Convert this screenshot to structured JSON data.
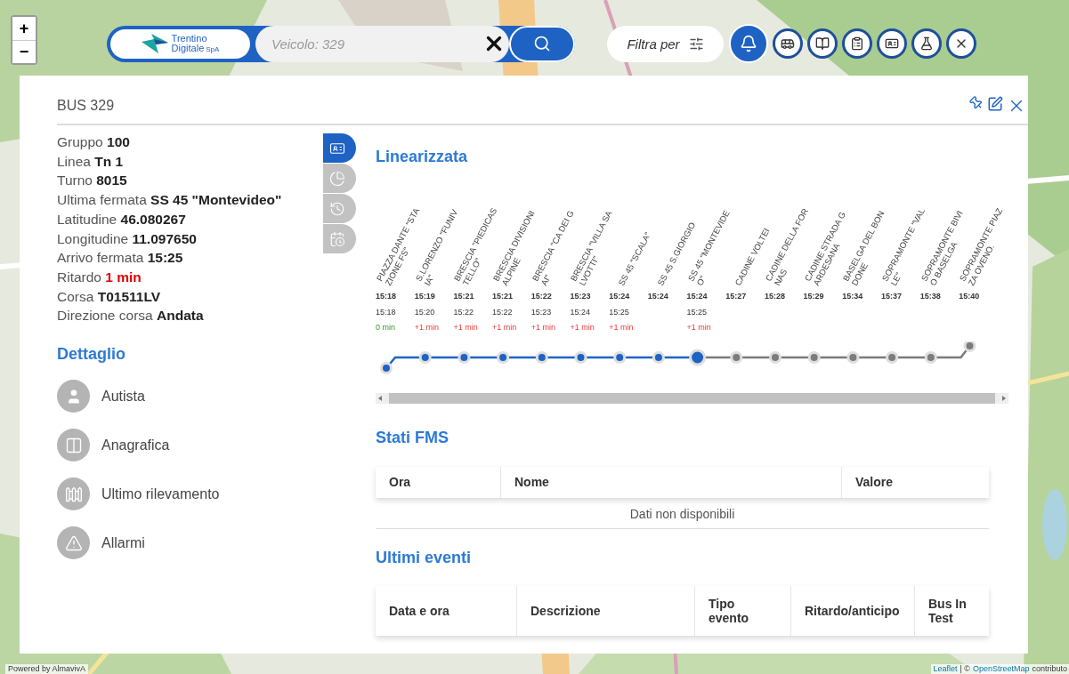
{
  "map_controls": {
    "zoom_in": "+",
    "zoom_out": "−"
  },
  "toolbar": {
    "logo": {
      "line1": "Trentino",
      "line2": "Digitale",
      "suffix": "SpA"
    },
    "search": {
      "placeholder": "Veicolo: 329"
    },
    "filter": {
      "label": "Filtra per"
    },
    "icon_buttons": [
      {
        "kind": "bell",
        "selected": true
      },
      {
        "kind": "bus",
        "selected": false
      },
      {
        "kind": "book",
        "selected": false
      },
      {
        "kind": "clipboard",
        "selected": false
      },
      {
        "kind": "card",
        "selected": false
      },
      {
        "kind": "flask",
        "selected": false
      },
      {
        "kind": "close",
        "selected": false
      }
    ]
  },
  "panel": {
    "title": "BUS 329",
    "fields": [
      {
        "label": "Gruppo",
        "value": "100",
        "alert": false
      },
      {
        "label": "Linea",
        "value": "Tn 1",
        "alert": false
      },
      {
        "label": "Turno",
        "value": "8015",
        "alert": false
      },
      {
        "label": "Ultima fermata",
        "value": "SS 45 \"Montevideo\"",
        "alert": false
      },
      {
        "label": "Latitudine",
        "value": "46.080267",
        "alert": false
      },
      {
        "label": "Longitudine",
        "value": "11.097650",
        "alert": false
      },
      {
        "label": "Arrivo fermata",
        "value": "15:25",
        "alert": false
      },
      {
        "label": "Ritardo",
        "value": "1 min",
        "alert": true
      },
      {
        "label": "Corsa",
        "value": "T01511LV",
        "alert": false
      },
      {
        "label": "Direzione corsa",
        "value": "Andata",
        "alert": false
      }
    ],
    "detail_title": "Dettaglio",
    "detail_items": [
      {
        "kind": "driver",
        "label": "Autista"
      },
      {
        "kind": "registry",
        "label": "Anagrafica"
      },
      {
        "kind": "survey",
        "label": "Ultimo rilevamento"
      },
      {
        "kind": "alarm",
        "label": "Allarmi"
      }
    ],
    "side_tabs": [
      {
        "kind": "card",
        "selected": true
      },
      {
        "kind": "chart",
        "selected": false
      },
      {
        "kind": "history",
        "selected": false
      },
      {
        "kind": "calendar",
        "selected": false
      }
    ],
    "linear": {
      "title": "Linearizzata",
      "stops": [
        {
          "name": "PIAZZA DANTE \"STAZIONE FS\"",
          "scheduled": "15:18",
          "actual": "15:18",
          "delay": "0 min",
          "late": false,
          "passed": true,
          "current": false
        },
        {
          "name": "S.LORENZO \"FUNIVIA\"",
          "scheduled": "15:19",
          "actual": "15:20",
          "delay": "+1 min",
          "late": true,
          "passed": true,
          "current": false
        },
        {
          "name": "BRESCIA \"PIEDICASTELLO\"",
          "scheduled": "15:21",
          "actual": "15:22",
          "delay": "+1 min",
          "late": true,
          "passed": true,
          "current": false
        },
        {
          "name": "BRESCIA DIVISIONI ALPINE",
          "scheduled": "15:21",
          "actual": "15:22",
          "delay": "+1 min",
          "late": true,
          "passed": true,
          "current": false
        },
        {
          "name": "BRESCIA \"CA DEI GAI\"",
          "scheduled": "15:22",
          "actual": "15:23",
          "delay": "+1 min",
          "late": true,
          "passed": true,
          "current": false
        },
        {
          "name": "BRESCIA \"VILLA SALVOTTI\"",
          "scheduled": "15:23",
          "actual": "15:24",
          "delay": "+1 min",
          "late": true,
          "passed": true,
          "current": false
        },
        {
          "name": "SS 45 \"SCALA\"",
          "scheduled": "15:24",
          "actual": "15:25",
          "delay": "+1 min",
          "late": true,
          "passed": true,
          "current": false
        },
        {
          "name": "SS 45 S.GIORGIO",
          "scheduled": "15:24",
          "passed": true,
          "current": false
        },
        {
          "name": "SS 45 \"MONTEVIDEO\"",
          "scheduled": "15:24",
          "actual": "15:25",
          "delay": "+1 min",
          "late": true,
          "passed": true,
          "current": true
        },
        {
          "name": "CADINE VOLTEI",
          "scheduled": "15:27",
          "passed": false,
          "current": false
        },
        {
          "name": "CADINE DELLA FORNAS",
          "scheduled": "15:28",
          "passed": false,
          "current": false
        },
        {
          "name": "CADINE STRADA GARDESANA",
          "scheduled": "15:29",
          "passed": false,
          "current": false
        },
        {
          "name": "BASELGA DEL BONDONE",
          "scheduled": "15:34",
          "passed": false,
          "current": false
        },
        {
          "name": "SOPRAMONTE \"VALLE\"",
          "scheduled": "15:37",
          "passed": false,
          "current": false
        },
        {
          "name": "SOPRAMONTE BIVIO BASELGA",
          "scheduled": "15:38",
          "passed": false,
          "current": false
        },
        {
          "name": "SOPRAMONTE PIAZZA OVENO.",
          "scheduled": "15:40",
          "passed": false,
          "current": false
        }
      ]
    },
    "fms": {
      "title": "Stati FMS",
      "columns": [
        "Ora",
        "Nome",
        "Valore"
      ],
      "empty": "Dati non disponibili"
    },
    "events": {
      "title": "Ultimi eventi",
      "columns": [
        "Data e ora",
        "Descrizione",
        "Tipo evento",
        "Ritardo/anticipo",
        "Bus In Test"
      ]
    }
  },
  "attribution": {
    "left": "Powered by AlmavivA",
    "right": [
      {
        "kind": "link",
        "text": "Leaflet"
      },
      {
        "kind": "text",
        "text": "| ©"
      },
      {
        "kind": "link",
        "text": "OpenStreetMap"
      },
      {
        "kind": "text",
        "text": "contributo"
      }
    ]
  }
}
